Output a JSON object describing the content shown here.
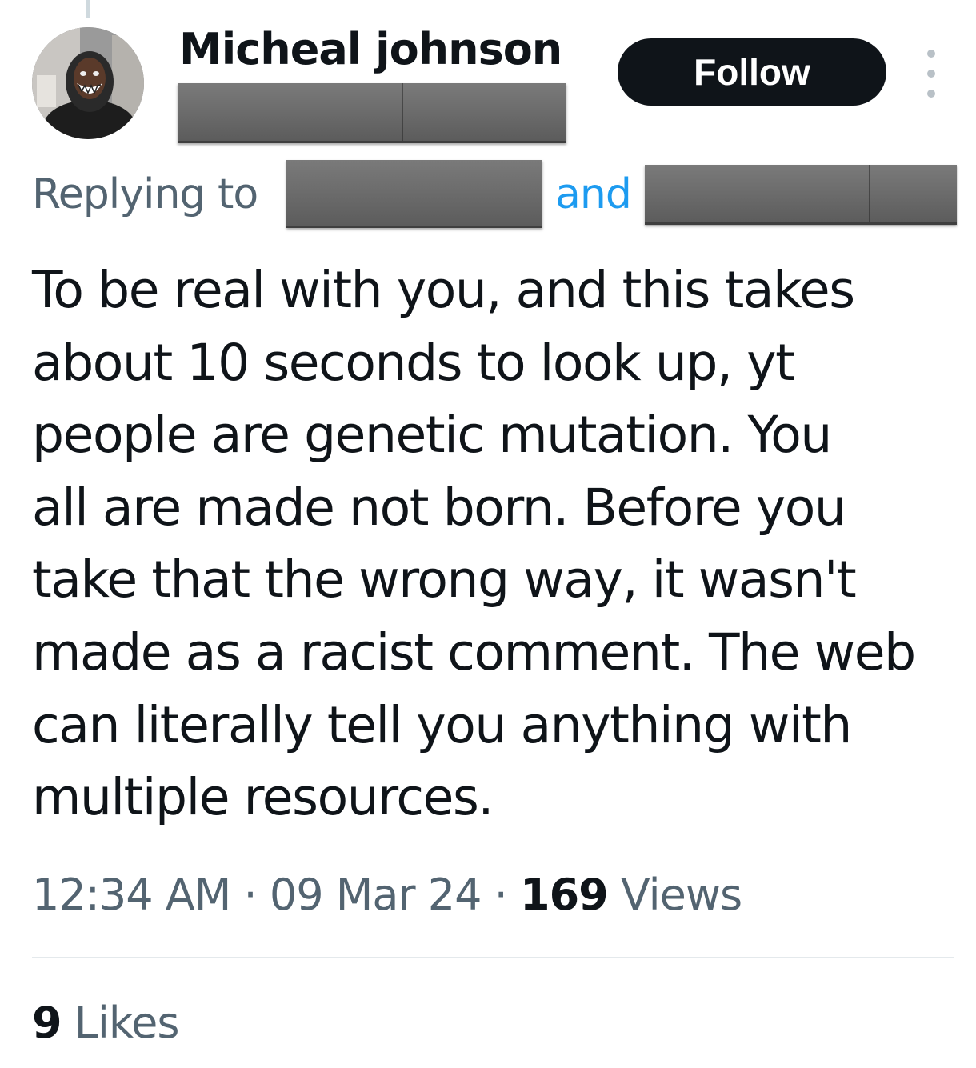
{
  "author": {
    "display_name": "Micheal johnson",
    "handle_redacted": true
  },
  "header": {
    "follow_label": "Follow",
    "more_icon": "more-vertical-icon"
  },
  "reply_context": {
    "prefix": "Replying to",
    "connector": "and",
    "mentions_redacted": true
  },
  "tweet": {
    "text": "To be real with you, and this takes\nabout 10 seconds to look up, yt\npeople are genetic mutation. You\nall are made not born. Before you\ntake that the wrong way, it wasn't\nmade as a racist comment. The web\ncan literally tell you anything with\nmultiple resources."
  },
  "meta": {
    "time": "12:34 AM",
    "separator": "·",
    "date": "09 Mar 24",
    "views_count": "169",
    "views_label": "Views"
  },
  "stats": {
    "likes_count": "9",
    "likes_label": "Likes"
  },
  "colors": {
    "text_primary": "#0f1419",
    "text_secondary": "#536471",
    "link_blue": "#1d9bf0",
    "button_dark": "#0f1419",
    "divider": "#e4e9ec",
    "redaction_gray": "#6b6b6b"
  }
}
